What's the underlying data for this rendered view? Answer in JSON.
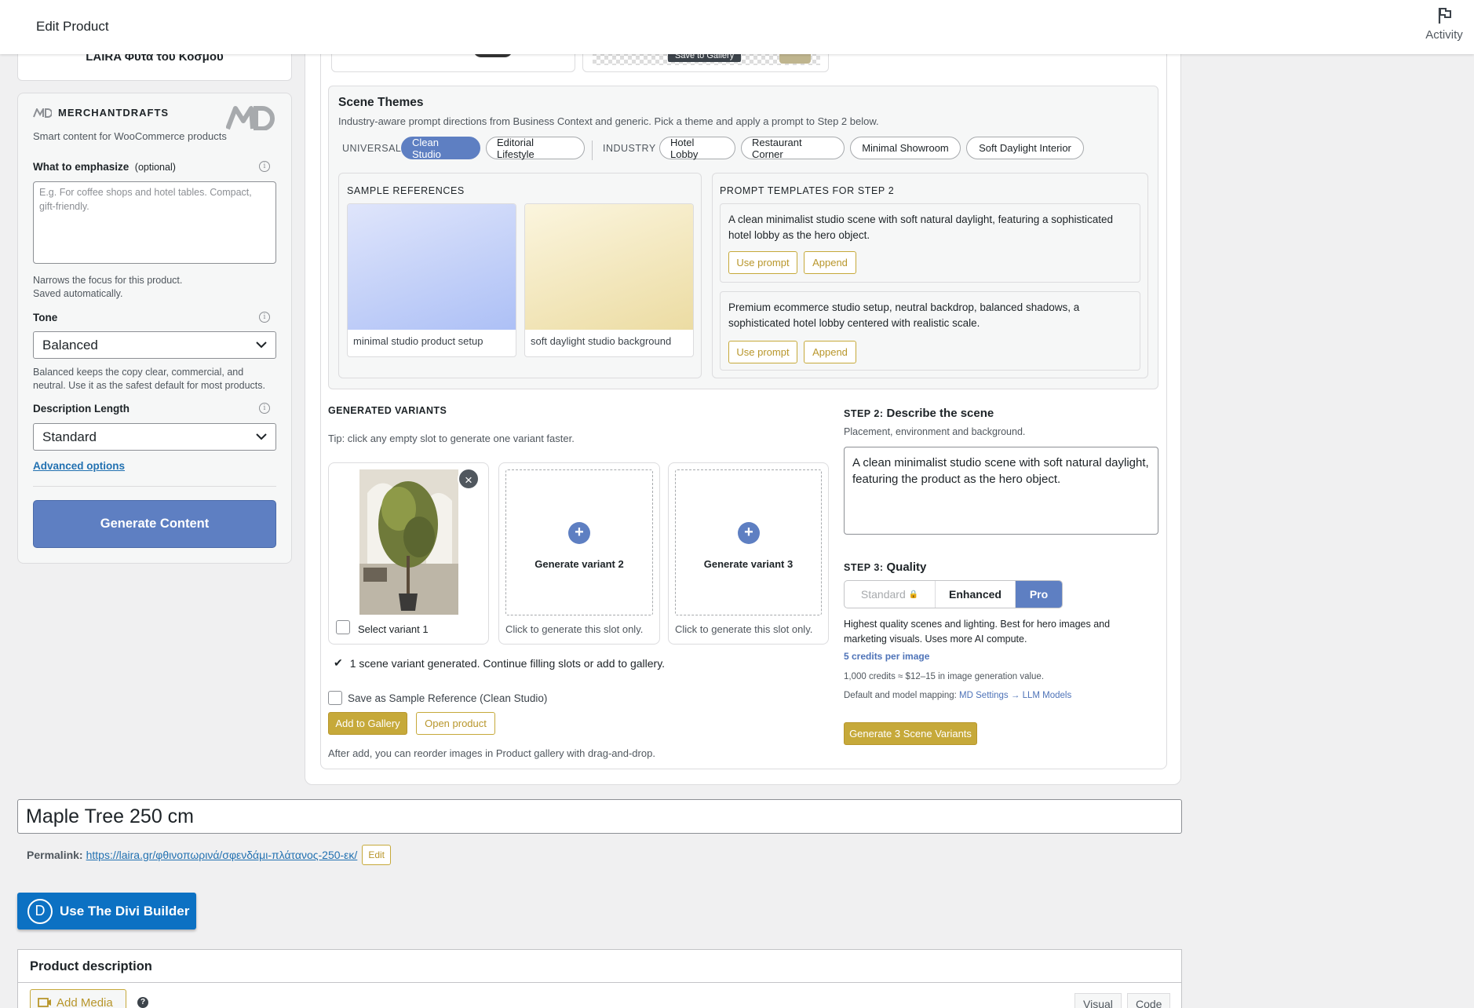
{
  "topbar": {
    "title": "Edit Product",
    "activity_label": "Activity"
  },
  "left": {
    "store_name": "LAIRA Φυτά του Κόσμου",
    "brand": {
      "name": "MERCHANTDRAFTS",
      "tagline": "Smart content for WooCommerce products"
    },
    "emphasize": {
      "label": "What to emphasize",
      "optional": "(optional)",
      "placeholder": "E.g. For coffee shops and hotel tables. Compact, gift-friendly.",
      "help_line1": "Narrows the focus for this product.",
      "help_line2": "Saved automatically."
    },
    "tone": {
      "label": "Tone",
      "value": "Balanced",
      "help": "Balanced keeps the copy clear, commercial, and neutral. Use it as the safest default for most products."
    },
    "length": {
      "label": "Description Length",
      "value": "Standard"
    },
    "advanced_link": "Advanced options",
    "generate_button": "Generate Content"
  },
  "top_strip": {
    "save_to_gallery": "Save to Gallery"
  },
  "themes": {
    "title": "Scene Themes",
    "subtitle": "Industry-aware prompt directions from Business Context and generic. Pick a theme and apply a prompt to Step 2 below.",
    "universal_label": "UNIVERSAL",
    "industry_label": "INDUSTRY",
    "universal_chips": [
      "Clean Studio",
      "Editorial Lifestyle"
    ],
    "industry_chips": [
      "Hotel Lobby",
      "Restaurant Corner",
      "Minimal Showroom",
      "Soft Daylight Interior"
    ],
    "active_chip": "Clean Studio",
    "samples": {
      "heading": "SAMPLE REFERENCES",
      "items": [
        {
          "caption": "minimal studio product setup",
          "color_from": "#dfe5fb",
          "color_to": "#adc0f6"
        },
        {
          "caption": "soft daylight studio background",
          "color_from": "#fbf5de",
          "color_to": "#ecdca3"
        }
      ]
    },
    "templates": {
      "heading": "PROMPT TEMPLATES FOR STEP 2",
      "items": [
        {
          "text": "A clean minimalist studio scene with soft natural daylight, featuring a sophisticated hotel lobby as the hero object.",
          "use": "Use prompt",
          "append": "Append"
        },
        {
          "text": "Premium ecommerce studio setup, neutral backdrop, balanced shadows, a sophisticated hotel lobby centered with realistic scale.",
          "use": "Use prompt",
          "append": "Append"
        }
      ]
    }
  },
  "variants": {
    "heading": "GENERATED VARIANTS",
    "tip": "Tip: click any empty slot to generate one variant faster.",
    "slot1": {
      "select_label": "Select variant 1"
    },
    "slot2": {
      "label": "Generate variant 2",
      "foot": "Click to generate this slot only."
    },
    "slot3": {
      "label": "Generate variant 3",
      "foot": "Click to generate this slot only."
    },
    "status": "1 scene variant generated. Continue filling slots or add to gallery.",
    "save_sample": "Save as Sample Reference (Clean Studio)",
    "add_to_gallery": "Add to Gallery",
    "open_product": "Open product",
    "after_add": "After add, you can reorder images in Product gallery with drag-and-drop."
  },
  "step2": {
    "prefix": "STEP 2:",
    "title": "Describe the scene",
    "sub": "Placement, environment and background.",
    "value": "A clean minimalist studio scene with soft natural daylight, featuring the product as the hero object."
  },
  "step3": {
    "prefix": "STEP 3:",
    "title": "Quality",
    "options": [
      "Standard",
      "Enhanced",
      "Pro"
    ],
    "selected": "Pro",
    "desc": "Highest quality scenes and lighting. Best for hero images and marketing visuals. Uses more AI compute.",
    "credits": "5 credits per image",
    "value_note": "1,000 credits ≈ $12–15 in image generation value.",
    "mapping_prefix": "Default and model mapping:",
    "mapping_link": "MD Settings → LLM Models",
    "generate_button": "Generate 3 Scene Variants"
  },
  "product": {
    "title": "Maple Tree 250 cm",
    "permalink_label": "Permalink:",
    "permalink_url": "https://laira.gr/φθινοπωρινά/σφενδάμι-πλάτανος-250-εκ/",
    "edit": "Edit",
    "divi_button": "Use The Divi Builder",
    "divi_letter": "D",
    "description_title": "Product description",
    "add_media": "Add Media",
    "help_q": "?",
    "tab_visual": "Visual",
    "tab_code": "Code"
  },
  "colors": {
    "accent": "#5e7fc2",
    "gold": "#c6a93a",
    "divi": "#0c71c3"
  }
}
